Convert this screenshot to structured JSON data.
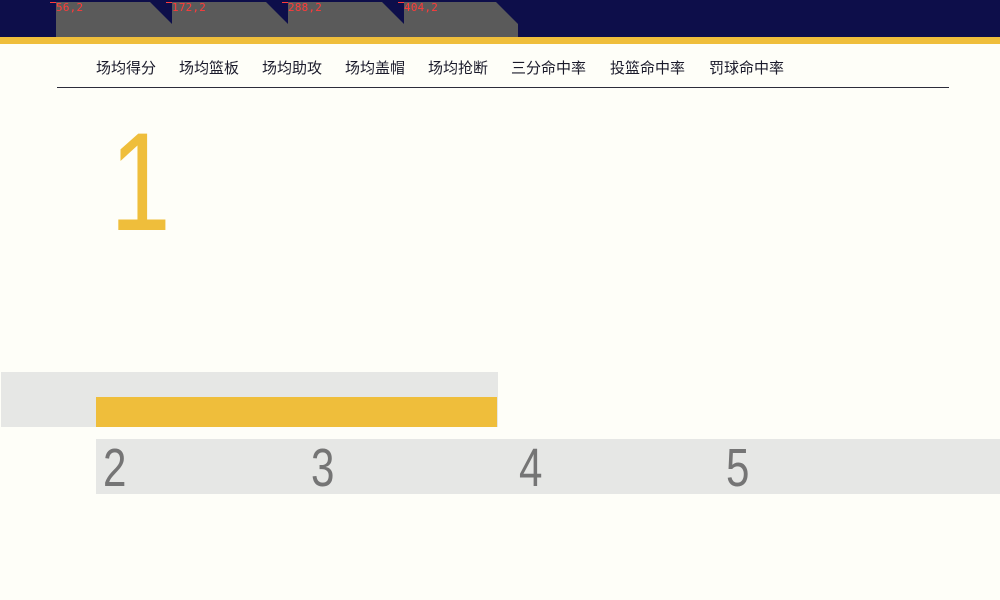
{
  "header_tabs": [
    {
      "coord_label": "56,2"
    },
    {
      "coord_label": "172,2"
    },
    {
      "coord_label": "288,2"
    },
    {
      "coord_label": "404,2"
    }
  ],
  "nav": {
    "items": [
      {
        "label": "场均得分"
      },
      {
        "label": "场均篮板"
      },
      {
        "label": "场均助攻"
      },
      {
        "label": "场均盖帽"
      },
      {
        "label": "场均抢断"
      },
      {
        "label": "三分命中率"
      },
      {
        "label": "投篮命中率"
      },
      {
        "label": "罚球命中率"
      }
    ]
  },
  "leader": {
    "rank": "1"
  },
  "other_ranks": [
    "2",
    "3",
    "4",
    "5"
  ],
  "colors": {
    "header_bg": "#0d0e4a",
    "accent_gold": "#efbe3b",
    "tab_gray": "#5a5a5a",
    "coord_red": "#ff3b3b",
    "panel_gray": "#e6e7e5",
    "rank_gray": "#757575"
  }
}
